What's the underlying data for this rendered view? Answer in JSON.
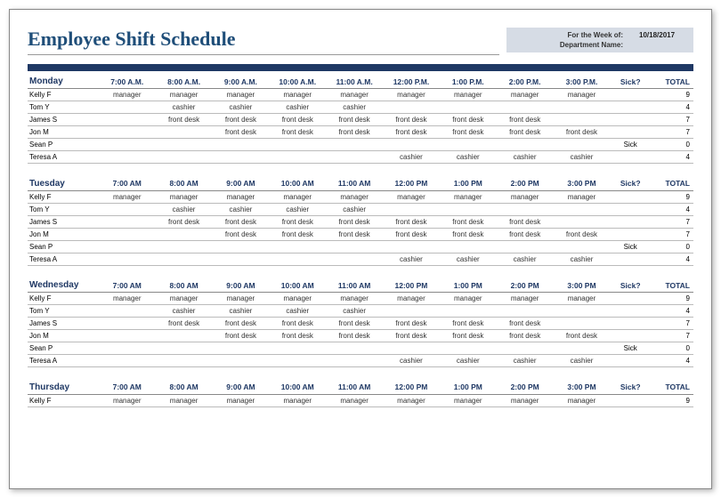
{
  "title": "Employee Shift Schedule",
  "meta": {
    "week_label": "For the Week of:",
    "week_value": "10/18/2017",
    "dept_label": "Department Name:",
    "dept_value": ""
  },
  "columns": {
    "sick": "Sick?",
    "total": "TOTAL"
  },
  "days": [
    {
      "name": "Monday",
      "times": [
        "7:00 A.M.",
        "8:00 A.M.",
        "9:00 A.M.",
        "10:00 A.M.",
        "11:00 A.M.",
        "12:00 P.M.",
        "1:00 P.M.",
        "2:00 P.M.",
        "3:00 P.M."
      ],
      "rows": [
        {
          "name": "Kelly F",
          "cells": [
            "manager",
            "manager",
            "manager",
            "manager",
            "manager",
            "manager",
            "manager",
            "manager",
            "manager"
          ],
          "sick": "",
          "total": "9"
        },
        {
          "name": "Tom Y",
          "cells": [
            "",
            "cashier",
            "cashier",
            "cashier",
            "cashier",
            "",
            "",
            "",
            ""
          ],
          "sick": "",
          "total": "4"
        },
        {
          "name": "James S",
          "cells": [
            "",
            "front desk",
            "front desk",
            "front desk",
            "front desk",
            "front desk",
            "front desk",
            "front desk",
            ""
          ],
          "sick": "",
          "total": "7"
        },
        {
          "name": "Jon M",
          "cells": [
            "",
            "",
            "front desk",
            "front desk",
            "front desk",
            "front desk",
            "front desk",
            "front desk",
            "front desk"
          ],
          "sick": "",
          "total": "7"
        },
        {
          "name": "Sean P",
          "cells": [
            "",
            "",
            "",
            "",
            "",
            "",
            "",
            "",
            ""
          ],
          "sick": "Sick",
          "total": "0"
        },
        {
          "name": "Teresa A",
          "cells": [
            "",
            "",
            "",
            "",
            "",
            "cashier",
            "cashier",
            "cashier",
            "cashier"
          ],
          "sick": "",
          "total": "4"
        }
      ]
    },
    {
      "name": "Tuesday",
      "times": [
        "7:00 AM",
        "8:00 AM",
        "9:00 AM",
        "10:00 AM",
        "11:00 AM",
        "12:00 PM",
        "1:00 PM",
        "2:00 PM",
        "3:00 PM"
      ],
      "rows": [
        {
          "name": "Kelly F",
          "cells": [
            "manager",
            "manager",
            "manager",
            "manager",
            "manager",
            "manager",
            "manager",
            "manager",
            "manager"
          ],
          "sick": "",
          "total": "9"
        },
        {
          "name": "Tom Y",
          "cells": [
            "",
            "cashier",
            "cashier",
            "cashier",
            "cashier",
            "",
            "",
            "",
            ""
          ],
          "sick": "",
          "total": "4"
        },
        {
          "name": "James S",
          "cells": [
            "",
            "front desk",
            "front desk",
            "front desk",
            "front desk",
            "front desk",
            "front desk",
            "front desk",
            ""
          ],
          "sick": "",
          "total": "7"
        },
        {
          "name": "Jon M",
          "cells": [
            "",
            "",
            "front desk",
            "front desk",
            "front desk",
            "front desk",
            "front desk",
            "front desk",
            "front desk"
          ],
          "sick": "",
          "total": "7"
        },
        {
          "name": "Sean P",
          "cells": [
            "",
            "",
            "",
            "",
            "",
            "",
            "",
            "",
            ""
          ],
          "sick": "Sick",
          "total": "0"
        },
        {
          "name": "Teresa A",
          "cells": [
            "",
            "",
            "",
            "",
            "",
            "cashier",
            "cashier",
            "cashier",
            "cashier"
          ],
          "sick": "",
          "total": "4"
        }
      ]
    },
    {
      "name": "Wednesday",
      "times": [
        "7:00 AM",
        "8:00 AM",
        "9:00 AM",
        "10:00 AM",
        "11:00 AM",
        "12:00 PM",
        "1:00 PM",
        "2:00 PM",
        "3:00 PM"
      ],
      "rows": [
        {
          "name": "Kelly F",
          "cells": [
            "manager",
            "manager",
            "manager",
            "manager",
            "manager",
            "manager",
            "manager",
            "manager",
            "manager"
          ],
          "sick": "",
          "total": "9"
        },
        {
          "name": "Tom Y",
          "cells": [
            "",
            "cashier",
            "cashier",
            "cashier",
            "cashier",
            "",
            "",
            "",
            ""
          ],
          "sick": "",
          "total": "4"
        },
        {
          "name": "James S",
          "cells": [
            "",
            "front desk",
            "front desk",
            "front desk",
            "front desk",
            "front desk",
            "front desk",
            "front desk",
            ""
          ],
          "sick": "",
          "total": "7"
        },
        {
          "name": "Jon M",
          "cells": [
            "",
            "",
            "front desk",
            "front desk",
            "front desk",
            "front desk",
            "front desk",
            "front desk",
            "front desk"
          ],
          "sick": "",
          "total": "7"
        },
        {
          "name": "Sean P",
          "cells": [
            "",
            "",
            "",
            "",
            "",
            "",
            "",
            "",
            ""
          ],
          "sick": "Sick",
          "total": "0"
        },
        {
          "name": "Teresa A",
          "cells": [
            "",
            "",
            "",
            "",
            "",
            "cashier",
            "cashier",
            "cashier",
            "cashier"
          ],
          "sick": "",
          "total": "4"
        }
      ]
    },
    {
      "name": "Thursday",
      "times": [
        "7:00 AM",
        "8:00 AM",
        "9:00 AM",
        "10:00 AM",
        "11:00 AM",
        "12:00 PM",
        "1:00 PM",
        "2:00 PM",
        "3:00 PM"
      ],
      "rows": [
        {
          "name": "Kelly F",
          "cells": [
            "manager",
            "manager",
            "manager",
            "manager",
            "manager",
            "manager",
            "manager",
            "manager",
            "manager"
          ],
          "sick": "",
          "total": "9"
        }
      ]
    }
  ]
}
